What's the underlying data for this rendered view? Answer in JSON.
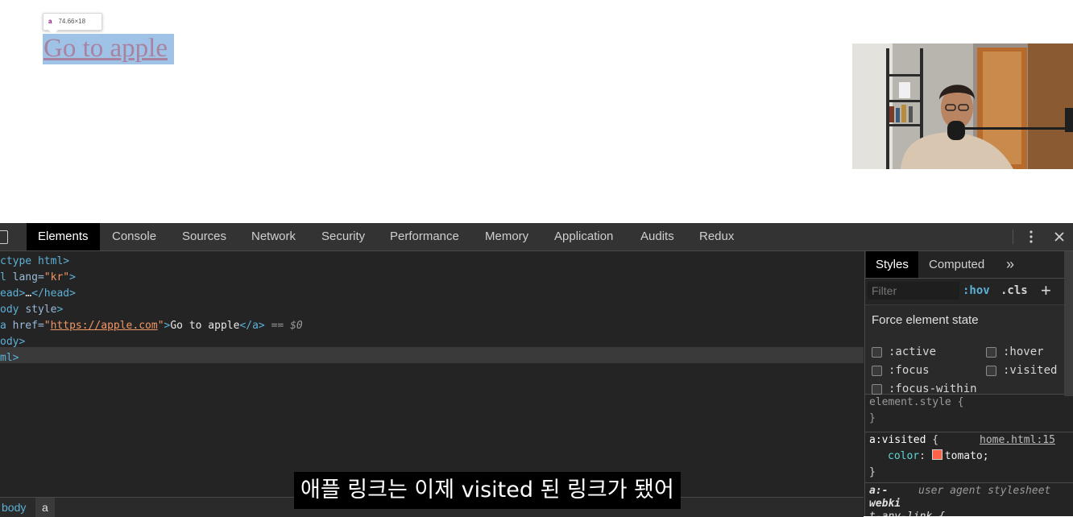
{
  "page": {
    "tooltip": {
      "tag": "a",
      "size": "74.66×18"
    },
    "link_text": "Go to apple"
  },
  "devtools": {
    "tabs": [
      "Elements",
      "Console",
      "Sources",
      "Network",
      "Security",
      "Performance",
      "Memory",
      "Application",
      "Audits",
      "Redux"
    ],
    "active_tab": "Elements",
    "dom_lines": {
      "l1": "ctype html>",
      "l2_a": "l ",
      "l2_attr": "lang=",
      "l2_val": "\"kr\"",
      "l2_b": ">",
      "l3_a": "ead>",
      "l3_b": "…",
      "l3_c": "</head>",
      "l4_a": "ody ",
      "l4_attr": "style",
      "l4_b": ">",
      "l5_a": "a ",
      "l5_attr": "href=",
      "l5_q1": "\"",
      "l5_link": "https://apple.com",
      "l5_q2": "\"",
      "l5_b": ">",
      "l5_text": "Go to apple",
      "l5_c": "</a>",
      "l5_eq": " == ",
      "l5_dollar": "$0",
      "l6": "ody>",
      "l7": "ml>"
    },
    "breadcrumbs": [
      "body",
      "a"
    ],
    "styles": {
      "tabs": [
        "Styles",
        "Computed"
      ],
      "more_label": "»",
      "filter_placeholder": "Filter",
      "hov_label": ":hov",
      "cls_label": ".cls",
      "plus_label": "+",
      "force_state_title": "Force element state",
      "states": [
        ":active",
        ":hover",
        ":focus",
        ":visited",
        ":focus-within"
      ],
      "element_style_open": "element.style {",
      "element_style_close": "}",
      "visited_selector": "a:visited",
      "visited_brace": " {",
      "visited_source": "home.html:15",
      "visited_prop": "color",
      "visited_value": "tomato;",
      "visited_close": "}",
      "ua_selector_1": "a:-",
      "ua_selector_2": "webki",
      "ua_label": "user agent stylesheet",
      "ua_line3": "t-any-link {"
    },
    "colors": {
      "swatch": "#ff6347"
    }
  },
  "subtitle": "애플 링크는 이제 visited 된 링크가 됐어"
}
